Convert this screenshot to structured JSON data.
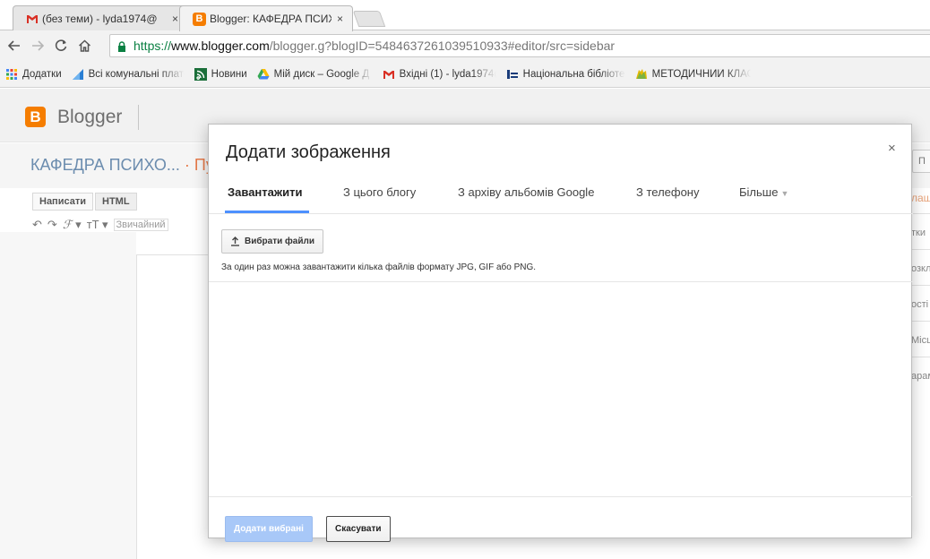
{
  "browser": {
    "tabs": [
      {
        "title": "(без теми) - lyda1974@",
        "close": "×",
        "icon": "gmail-icon"
      },
      {
        "title": "Blogger: КАФЕДРА ПСИХ",
        "close": "×",
        "icon": "blogger-icon"
      }
    ],
    "url": {
      "scheme": "https://",
      "host": "www.blogger.com",
      "path": "/blogger.g?blogID=5484637261039510933#editor/src=sidebar"
    },
    "bookmarks": [
      {
        "label": "Додатки",
        "icon": "apps-grid-icon"
      },
      {
        "label": "Всі комунальні плате",
        "icon": "payments-icon"
      },
      {
        "label": "Новини",
        "icon": "news-icon"
      },
      {
        "label": "Мій диск – Google Д",
        "icon": "google-drive-icon"
      },
      {
        "label": "Вхідні (1) - lyda1974@",
        "icon": "gmail-icon"
      },
      {
        "label": "Національна бібліоте",
        "icon": "library-icon"
      },
      {
        "label": "МЕТОДИЧНИЙ КЛАС",
        "icon": "folder-icon"
      }
    ]
  },
  "blogger": {
    "brand": "Blogger",
    "blog_title": "КАФЕДРА ПСИХО...",
    "title_suffix": "· Пу",
    "mode_tabs": [
      "Написати",
      "HTML"
    ],
    "paragraph_style": "Звичайний",
    "header_button_stub": "П",
    "right_items": [
      {
        "text": "лаш",
        "orange": true
      },
      {
        "text": "тки"
      },
      {
        "text": "озкл"
      },
      {
        "text": "ості"
      },
      {
        "text": "Місце"
      },
      {
        "text": "арам"
      }
    ]
  },
  "dialog": {
    "title": "Додати зображення",
    "close": "×",
    "tabs": [
      {
        "label": "Завантажити",
        "selected": true
      },
      {
        "label": "З цього блогу"
      },
      {
        "label": "З архіву альбомів Google"
      },
      {
        "label": "З телефону"
      },
      {
        "label": "Більше",
        "dropdown": true
      }
    ],
    "choose_files": "Вибрати файли",
    "hint": "За один раз можна завантажити кілька файлів формату JPG, GIF або PNG.",
    "add_selected": "Додати вибрані",
    "cancel": "Скасувати"
  },
  "colors": {
    "blogger_orange": "#f57d00",
    "accent_blue": "#4d90fe",
    "disabled_blue": "#a8c8f8",
    "secure_green": "#0b8043"
  }
}
